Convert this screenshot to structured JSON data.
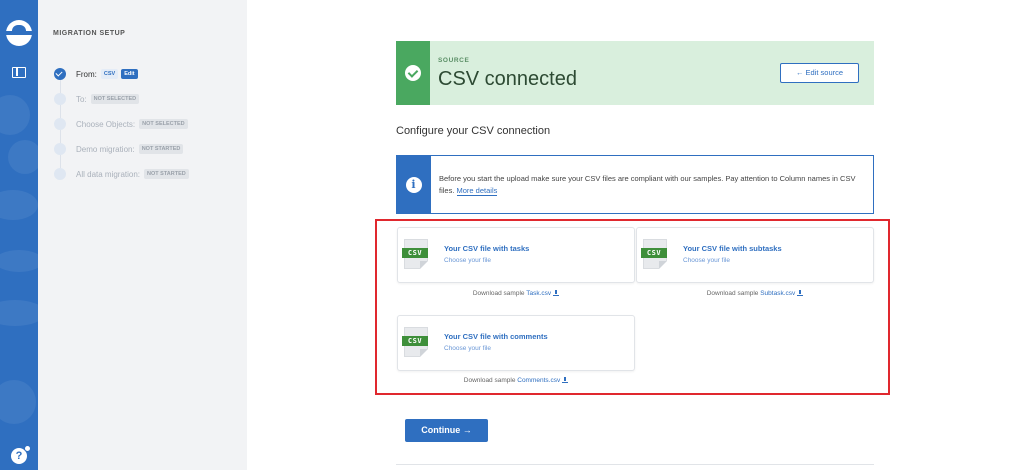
{
  "sidebar": {
    "title": "MIGRATION SETUP",
    "steps": [
      {
        "label": "From:",
        "badge": "CSV",
        "action": "Edit"
      },
      {
        "label": "To:",
        "badge": "NOT SELECTED"
      },
      {
        "label": "Choose Objects:",
        "badge": "NOT SELECTED"
      },
      {
        "label": "Demo migration:",
        "badge": "NOT STARTED"
      },
      {
        "label": "All data migration:",
        "badge": "NOT STARTED"
      }
    ]
  },
  "source": {
    "label": "SOURCE",
    "title": "CSV connected",
    "edit_button": "← Edit source",
    "accent": "#4aa860"
  },
  "configure": {
    "title": "Configure your CSV connection"
  },
  "info": {
    "text": "Before you start the upload make sure your CSV files are compliant with our samples. Pay attention to Column names in CSV files.",
    "link": "More details"
  },
  "files": [
    {
      "title": "Your CSV file with tasks",
      "sub": "Choose your file",
      "sample_prefix": "Download sample",
      "sample_link": "Task.csv"
    },
    {
      "title": "Your CSV file with subtasks",
      "sub": "Choose your file",
      "sample_prefix": "Download sample",
      "sample_link": "Subtask.csv"
    },
    {
      "title": "Your CSV file with comments",
      "sub": "Choose your file",
      "sample_prefix": "Download sample",
      "sample_link": "Comments.csv"
    }
  ],
  "file_icon_label": "CSV",
  "continue_button": "Continue →",
  "colors": {
    "primary": "#2f6fc0",
    "success": "#4aa860",
    "highlight": "#e0282e"
  },
  "icons": [
    "logo-icon",
    "layout-icon",
    "help-icon",
    "check-icon",
    "info-icon",
    "download-icon",
    "csv-file-icon"
  ]
}
